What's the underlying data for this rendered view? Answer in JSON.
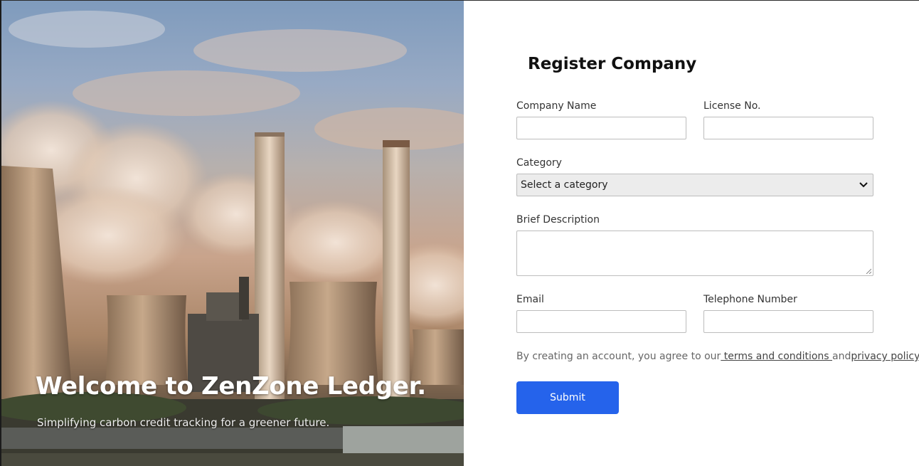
{
  "hero": {
    "title": "Welcome to ZenZone Ledger.",
    "subtitle": "Simplifying carbon credit tracking for a greener future."
  },
  "form": {
    "title": "Register Company",
    "company_name": {
      "label": "Company Name",
      "value": ""
    },
    "license_no": {
      "label": "License No.",
      "value": ""
    },
    "category": {
      "label": "Category",
      "selected": "Select a category"
    },
    "description": {
      "label": "Brief Description",
      "value": ""
    },
    "email": {
      "label": "Email",
      "value": ""
    },
    "telephone": {
      "label": "Telephone Number",
      "value": ""
    },
    "terms": {
      "prefix": "By creating an account, you agree to our",
      "terms_link": " terms and conditions ",
      "and": "and",
      "privacy_link": "privacy policy",
      "suffix": "."
    },
    "submit_label": "Submit"
  },
  "colors": {
    "accent": "#2563eb"
  }
}
